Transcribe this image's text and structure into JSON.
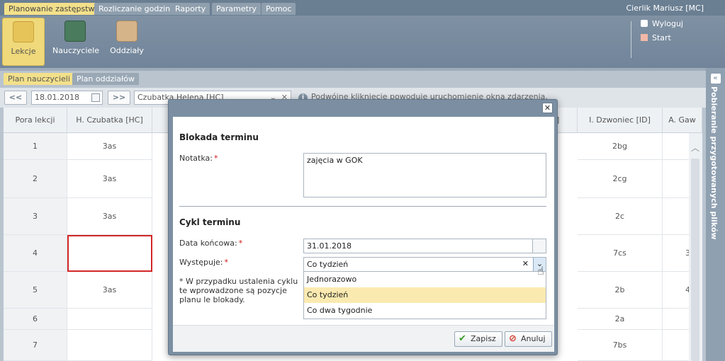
{
  "topbar": {
    "tabs": [
      "Planowanie zastępstw",
      "Rozliczanie godzin",
      "Raporty",
      "Parametry",
      "Pomoc"
    ],
    "user": "Cierlik Mariusz [MC]"
  },
  "ribbon": {
    "buttons": [
      "Lekcje",
      "Nauczyciele",
      "Oddziały"
    ],
    "links": [
      "Wyloguj",
      "Start"
    ]
  },
  "subtabs": [
    "Plan nauczycieli",
    "Plan oddziałów"
  ],
  "toolbar": {
    "prev": "<<",
    "date": "18.01.2018",
    "next": ">>",
    "teacher": "Czubatka Helena [HC]",
    "hint": "Podwójne kliknięcie powoduje uruchomienie okna zdarzenia."
  },
  "grid": {
    "headers": [
      "Pora lekcji",
      "H. Czubatka [HC]",
      "",
      "",
      "",
      "",
      "]",
      "I. Dzwoniec [ID]",
      "A. Gaw"
    ],
    "rows": [
      {
        "n": "1",
        "hc": "3as",
        "id": "2bg",
        "ag": ""
      },
      {
        "n": "2",
        "hc": "3as",
        "id": "2cg",
        "ag": ""
      },
      {
        "n": "3",
        "hc": "3as",
        "id": "2c",
        "ag": ""
      },
      {
        "n": "4",
        "hc": "",
        "id": "7cs",
        "ag": "3"
      },
      {
        "n": "5",
        "hc": "3as",
        "id": "2b",
        "ag": "4"
      },
      {
        "n": "6",
        "hc": "",
        "id": "2a",
        "ag": ""
      },
      {
        "n": "7",
        "hc": "",
        "id": "7bs",
        "ag": ""
      }
    ]
  },
  "side_panel": {
    "label": "Pobieranie przygotowanych plików"
  },
  "modal": {
    "section1": "Blokada terminu",
    "note_label": "Notatka:",
    "note_value": "zajęcia w GOK",
    "section2": "Cykl terminu",
    "end_date_label": "Data końcowa:",
    "end_date_value": "31.01.2018",
    "occurs_label": "Występuje:",
    "occurs_value": "Co tydzień",
    "options": [
      "Jednorazowo",
      "Co tydzień",
      "Co dwa tygodnie"
    ],
    "footnote": "* W przypadku ustalenia cyklu te wprowadzone są pozycje planu le blokady.",
    "save": "Zapisz",
    "cancel": "Anuluj"
  },
  "colors": {
    "accent": "#f3e08a",
    "header": "#6b7f93",
    "error": "#d32727"
  }
}
